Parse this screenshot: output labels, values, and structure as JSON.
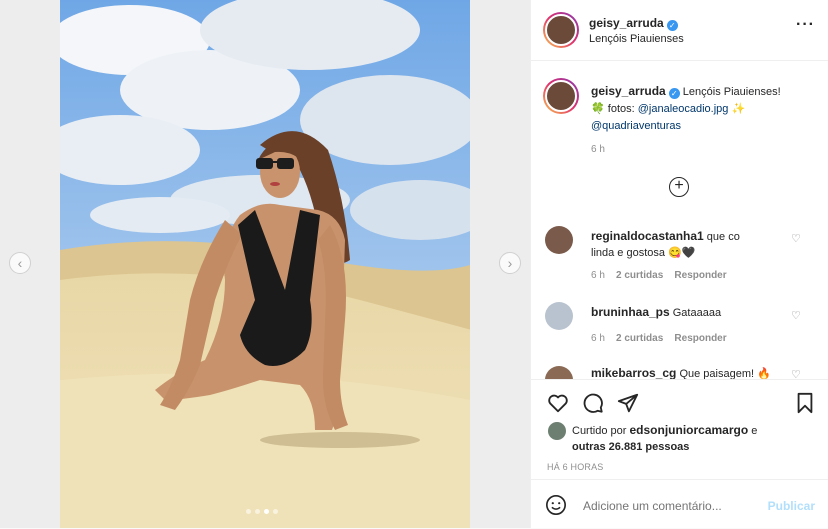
{
  "post": {
    "author": "geisy_arruda",
    "location": "Lençóis Piauienses",
    "caption": {
      "line1": "Lençóis Piauienses!",
      "line2_prefix": "fotos: ",
      "photographer": "@janaleocadio.jpg",
      "line3_mention": "@quadriaventuras",
      "clover_emoji": "🍀",
      "sparkle_emoji": "✨",
      "time": "6 h"
    }
  },
  "comments": [
    {
      "user": "reginaldocastanha1",
      "text_line1": "que co",
      "text_line2": "linda e gostosa",
      "emoji": "😋🖤",
      "time": "6 h",
      "likes": "2 curtidas",
      "reply": "Responder"
    },
    {
      "user": "bruninhaa_ps",
      "text": "Gataaaaa",
      "time": "6 h",
      "likes": "2 curtidas",
      "reply": "Responder"
    },
    {
      "user": "mikebarros_cg",
      "text": "Que paisagem!",
      "emoji": "🔥"
    }
  ],
  "likes": {
    "prefix": "Curtido por",
    "user": "edsonjuniorcamargo",
    "connector": "e",
    "others": "outras 26.881 pessoas"
  },
  "timestamp": "HÁ 6 HORAS",
  "comment_input": {
    "placeholder": "Adicione um comentário...",
    "publish": "Publicar"
  },
  "carousel": {
    "count": 4,
    "active": 2
  },
  "icons": {
    "more": "more-options-icon",
    "add": "load-more-comments-icon",
    "like": "heart-icon",
    "comment": "comment-icon",
    "share": "share-icon",
    "save": "bookmark-icon",
    "emoji": "emoji-icon",
    "prev": "chevron-left-icon",
    "next": "chevron-right-icon"
  },
  "colors": {
    "verified": "#3897f0",
    "link": "#00376b",
    "muted": "#8e8e8e",
    "publish": "#b2dffc"
  }
}
